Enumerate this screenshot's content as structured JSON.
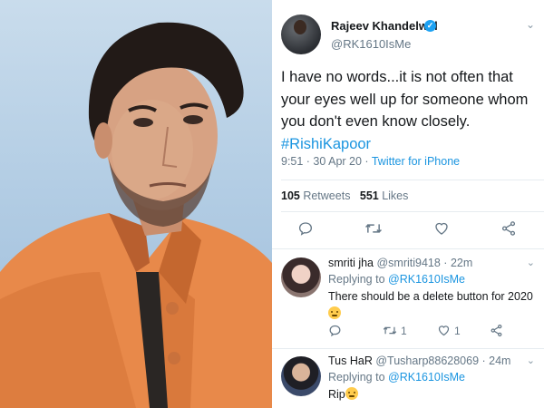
{
  "tweet": {
    "author_name": "Rajeev Khandelwal",
    "handle": "@RK1610IsMe",
    "text": "I have no words...it is not often that your eyes well up for someone whom you don't even know closely.",
    "hashtag": "#RishiKapoor",
    "time": "9:51 · 30 Apr 20 · ",
    "source": "Twitter for iPhone",
    "retweets_count": "105",
    "retweets_label": " Retweets",
    "likes_count": "551",
    "likes_label": " Likes"
  },
  "replies": [
    {
      "name": "smriti jha",
      "handle_time": " @smriti9418 · 22m",
      "replying_prefix": "Replying to ",
      "replying_to": "@RK1610IsMe",
      "text": "There should be a delete button for 2020",
      "retweets": "1",
      "likes": "1"
    },
    {
      "name": "Tus HaR",
      "handle_time": " @Tusharp88628069 · 24m",
      "replying_prefix": "Replying to ",
      "replying_to": "@RK1610IsMe",
      "text": "Rip"
    }
  ],
  "icons": {
    "verified": "verified-badge-icon",
    "more": "chevron-down-icon",
    "reply": "reply-icon",
    "retweet": "retweet-icon",
    "like": "heart-icon",
    "share": "share-icon"
  },
  "colors": {
    "twitter_blue": "#1b95e0",
    "verified_blue": "#1da1f2",
    "muted_text": "#657786",
    "divider": "#e6ecf0"
  },
  "verified_mark": "✓",
  "caret_glyph": "⌄"
}
